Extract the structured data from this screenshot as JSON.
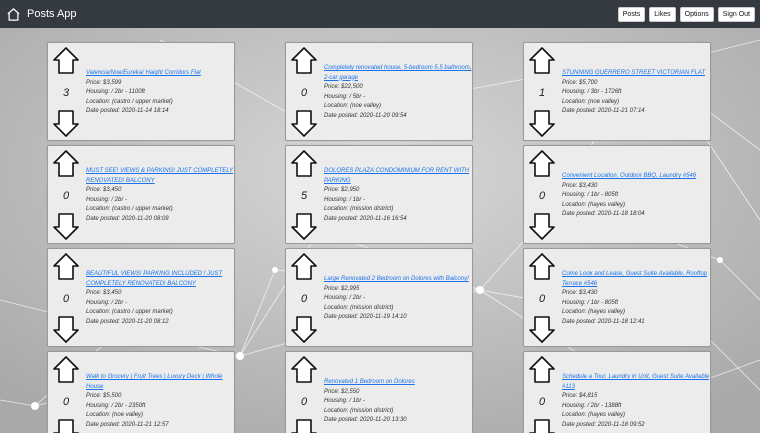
{
  "app": {
    "title": "Posts App"
  },
  "nav": {
    "posts": "Posts",
    "likes": "Likes",
    "options": "Options",
    "signout": "Sign Out"
  },
  "labels": {
    "price": "Price: ",
    "housing": "Housing: ",
    "location": "Location: ",
    "date": "Date posted: "
  },
  "colors": {
    "navbar": "#343a40",
    "link": "#1a73e8",
    "card": "#ececec"
  },
  "posts": [
    {
      "title": "Valencia/Noe/Eureka/ Haight Corridors Flat",
      "votes": "3",
      "price": "Price: $3,599",
      "housing": "Housing: / 2br - 1100ft",
      "location": "Location: (castro / upper market)",
      "date": "Date posted: 2020-11-14 18:14"
    },
    {
      "title": "Completely renovated house, 5-bedroom 5.5 bathroom, 2-car garage",
      "votes": "0",
      "price": "Price: $22,500",
      "housing": "Housing: / 5br -",
      "location": "Location: (noe valley)",
      "date": "Date posted: 2020-11-20 09:54"
    },
    {
      "title": "STUNNING GUERRERO STREET VICTORIAN FLAT",
      "votes": "1",
      "price": "Price: $5,700",
      "housing": "Housing: / 3br - 1726ft",
      "location": "Location: (noe valley)",
      "date": "Date posted: 2020-11-21 07:14"
    },
    {
      "title": "MUST SEE! VIEWS & PARKING! JUST COMPLETELY RENOVATED! BALCONY",
      "votes": "0",
      "price": "Price: $3,450",
      "housing": "Housing: / 2br -",
      "location": "Location: (castro / upper market)",
      "date": "Date posted: 2020-11-20 08:09"
    },
    {
      "title": "DOLORES PLAZA CONDOMINIUM FOR RENT WITH PARKING",
      "votes": "5",
      "price": "Price: $2,950",
      "housing": "Housing: / 1br -",
      "location": "Location: (mission district)",
      "date": "Date posted: 2020-11-16 16:54"
    },
    {
      "title": "Convenient Location, Outdoor BBQ, Laundry #546",
      "votes": "0",
      "price": "Price: $3,430",
      "housing": "Housing: / 1br - 805ft",
      "location": "Location: (hayes valley)",
      "date": "Date posted: 2020-11-18 18:04"
    },
    {
      "title": "BEAUTIFUL VIEWS! PARKING INCLUDED ! JUST COMPLETELY RENOVATED! BALCONY",
      "votes": "0",
      "price": "Price: $3,450",
      "housing": "Housing: / 2br -",
      "location": "Location: (castro / upper market)",
      "date": "Date posted: 2020-11-20 08:12"
    },
    {
      "title": "Large Renovated 2 Bedroom on Dolores with Balcony!",
      "votes": "0",
      "price": "Price: $2,995",
      "housing": "Housing: / 2br -",
      "location": "Location: (mission district)",
      "date": "Date posted: 2020-11-19 14:10"
    },
    {
      "title": "Come Look and Lease, Guest Suite Available, Rooftop Terrace #546",
      "votes": "0",
      "price": "Price: $3,430",
      "housing": "Housing: / 1br - 805ft",
      "location": "Location: (hayes valley)",
      "date": "Date posted: 2020-11-18 12:41"
    },
    {
      "title": "Walk to Grocery | Fruit Trees | Luxury Deck | Whole House",
      "votes": "0",
      "price": "Price: $5,500",
      "housing": "Housing: / 2br - 2350ft",
      "location": "Location: (noe valley)",
      "date": "Date posted: 2020-11-21 12:57"
    },
    {
      "title": "Renovated 1 Bedroom on Dolores",
      "votes": "0",
      "price": "Price: $2,550",
      "housing": "Housing: / 1br -",
      "location": "Location: (mission district)",
      "date": "Date posted: 2020-11-20 13:30"
    },
    {
      "title": "Schedule a Tour, Laundry in Unit, Guest Suite Available #113",
      "votes": "0",
      "price": "Price: $4,815",
      "housing": "Housing: / 2br - 1388ft",
      "location": "Location: (hayes valley)",
      "date": "Date posted: 2020-11-18 09:52"
    }
  ]
}
